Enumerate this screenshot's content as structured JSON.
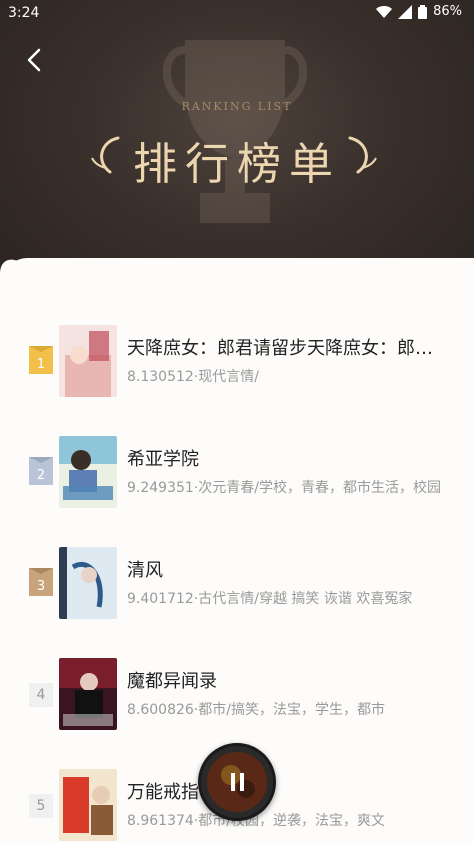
{
  "status_bar": {
    "time": "3:24",
    "battery": "86%"
  },
  "header": {
    "subtitle": "RANKING LIST",
    "title": "排行榜单"
  },
  "colors": {
    "header_bg": "#3a302b",
    "gold": "#ecd6b0",
    "rank1": "#f2c04a",
    "rank2": "#b9c4d6",
    "rank3": "#c8a47c"
  },
  "books": [
    {
      "rank": "1",
      "title": "天降庶女：郎君请留步天降庶女：郎君请留步",
      "meta": "8.130512·现代言情/"
    },
    {
      "rank": "2",
      "title": "希亚学院",
      "meta": "9.249351·次元青春/学校，青春，都市生活，校园"
    },
    {
      "rank": "3",
      "title": "清风",
      "meta": "9.401712·古代言情/穿越 搞笑 诙谐 欢喜冤家"
    },
    {
      "rank": "4",
      "title": "魔都异闻录",
      "meta": "8.600826·都市/搞笑，法宝，学生，都市"
    },
    {
      "rank": "5",
      "title": "万能戒指",
      "meta": "8.961374·都市/校园，逆袭，法宝，爽文"
    }
  ]
}
